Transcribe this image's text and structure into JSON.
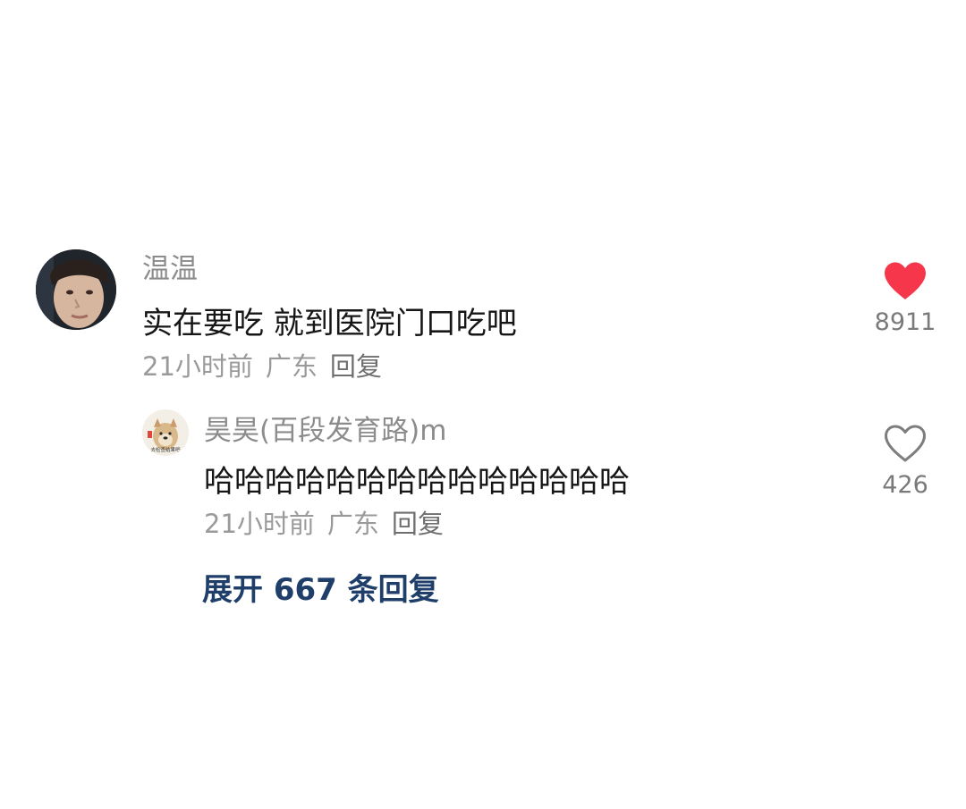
{
  "comment": {
    "username": "温温",
    "text": "实在要吃 就到医院门口吃吧",
    "time": "21小时前",
    "location": "广东",
    "reply_label": "回复",
    "like_count": "8911",
    "liked": true,
    "like_color": "#f5364b"
  },
  "reply": {
    "username": "昊昊(百段发育路)m",
    "avatar_text": "去检查结果吧",
    "text": "哈哈哈哈哈哈哈哈哈哈哈哈哈哈",
    "time": "21小时前",
    "location": "广东",
    "reply_label": "回复",
    "like_count": "426",
    "liked": false
  },
  "expand_label": "展开 667 条回复"
}
